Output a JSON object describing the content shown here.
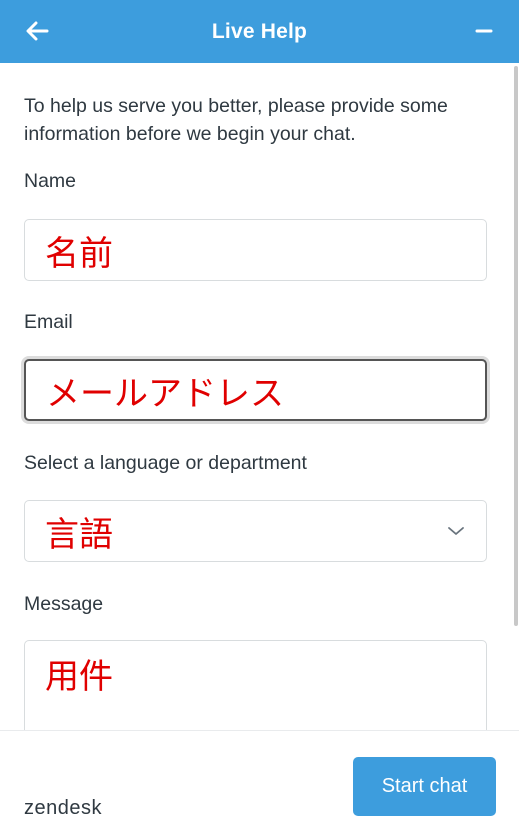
{
  "header": {
    "title": "Live Help",
    "back_icon": "arrow-left-icon",
    "minimize_icon": "minus-icon"
  },
  "form": {
    "intro": "To help us serve you better, please provide some information before we begin your chat.",
    "name": {
      "label": "Name",
      "value": "名前"
    },
    "email": {
      "label": "Email",
      "value": "メールアドレス"
    },
    "department": {
      "label": "Select a language or department",
      "value": "言語"
    },
    "message": {
      "label": "Message",
      "value": "用件"
    }
  },
  "footer": {
    "logo": "zendesk",
    "start_label": "Start chat"
  },
  "colors": {
    "brand": "#3d9ddd",
    "value_text": "#e00000"
  }
}
